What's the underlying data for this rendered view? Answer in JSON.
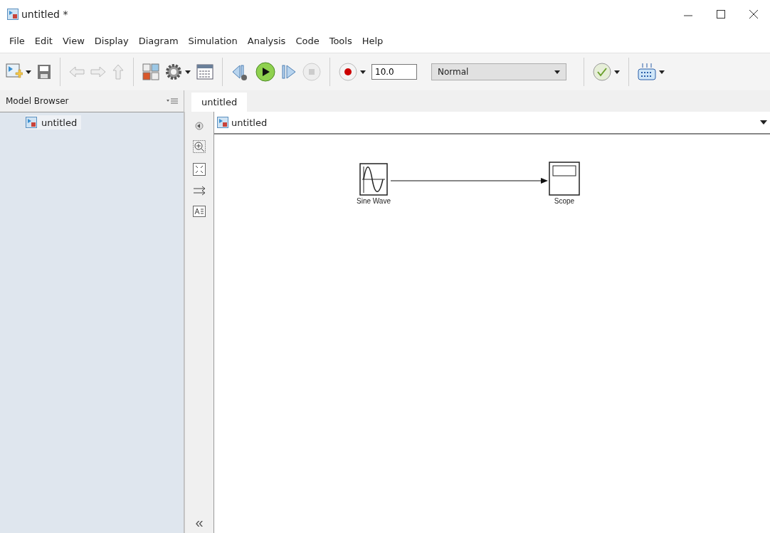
{
  "window": {
    "title": "untitled *"
  },
  "menu": [
    "File",
    "Edit",
    "View",
    "Display",
    "Diagram",
    "Simulation",
    "Analysis",
    "Code",
    "Tools",
    "Help"
  ],
  "toolbar": {
    "stop_time": {
      "value": "10.0"
    },
    "mode": {
      "value": "Normal"
    }
  },
  "model_browser": {
    "title": "Model Browser",
    "items": [
      {
        "label": "untitled",
        "selected": true
      }
    ]
  },
  "tabs": [
    {
      "label": "untitled",
      "selected": true
    }
  ],
  "breadcrumb": "untitled",
  "palette": {
    "collapse": "«"
  },
  "blocks": [
    {
      "kind": "sine",
      "label": "Sine Wave"
    },
    {
      "kind": "scope",
      "label": "Scope"
    }
  ]
}
